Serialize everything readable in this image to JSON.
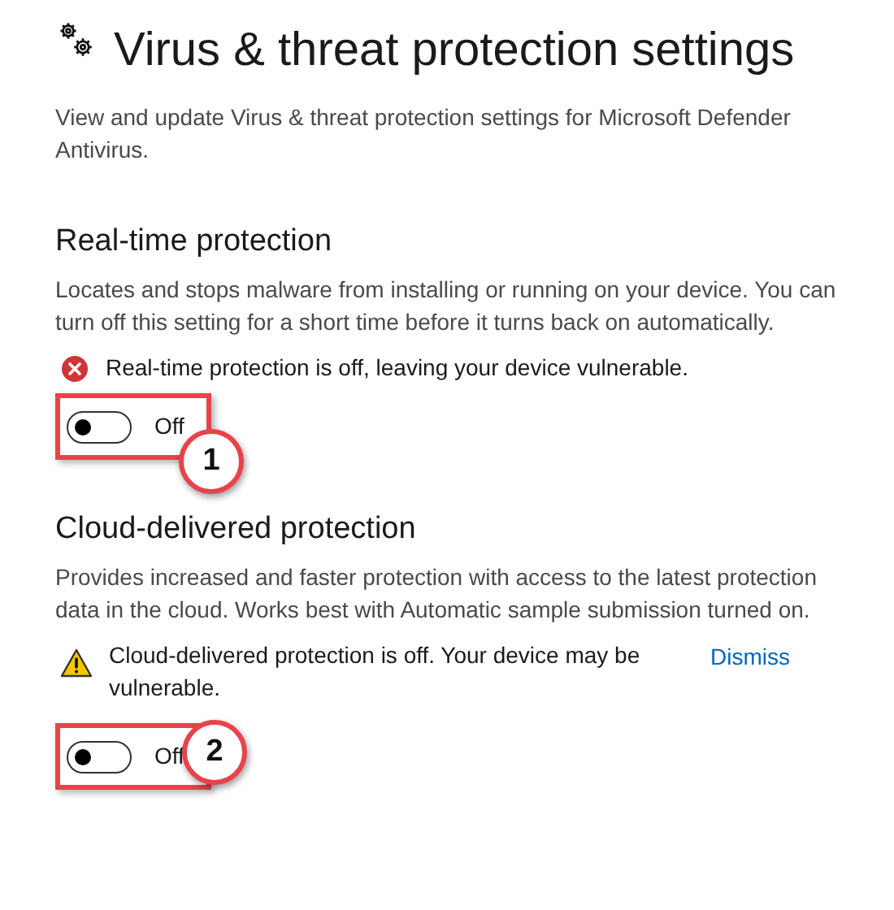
{
  "page": {
    "title": "Virus & threat protection settings",
    "description": "View and update Virus & threat protection settings for Microsoft Defender Antivirus."
  },
  "sections": [
    {
      "heading": "Real-time protection",
      "body": "Locates and stops malware from installing or running on your device. You can turn off this setting for a short time before it turns back on automatically.",
      "status": {
        "kind": "error",
        "message": "Real-time protection is off, leaving your device vulnerable."
      },
      "toggle": {
        "on": false,
        "label": "Off"
      },
      "annotation": {
        "label": "1"
      }
    },
    {
      "heading": "Cloud-delivered protection",
      "body": "Provides increased and faster protection with access to the latest protection data in the cloud. Works best with Automatic sample submission turned on.",
      "status": {
        "kind": "warning",
        "message": "Cloud-delivered protection is off. Your device may be vulnerable.",
        "link": "Dismiss"
      },
      "toggle": {
        "on": false,
        "label": "Off"
      },
      "annotation": {
        "label": "2"
      }
    }
  ]
}
